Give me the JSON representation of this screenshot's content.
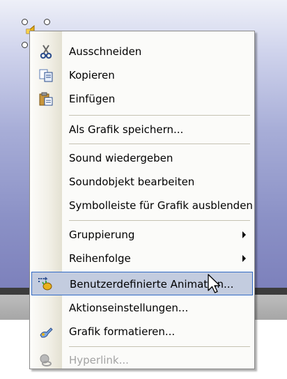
{
  "menu": {
    "items": [
      {
        "label": "Ausschneiden",
        "icon": "scissors-icon",
        "enabled": true
      },
      {
        "label": "Kopieren",
        "icon": "copy-icon",
        "enabled": true
      },
      {
        "label": "Einfügen",
        "icon": "paste-icon",
        "enabled": true
      },
      {
        "label": "Als Grafik speichern...",
        "enabled": true
      },
      {
        "label": "Sound wiedergeben",
        "enabled": true
      },
      {
        "label": "Soundobjekt bearbeiten",
        "enabled": true
      },
      {
        "label": "Symbolleiste für Grafik ausblenden",
        "enabled": true
      },
      {
        "label": "Gruppierung",
        "submenu": true,
        "enabled": true
      },
      {
        "label": "Reihenfolge",
        "submenu": true,
        "enabled": true
      },
      {
        "label": "Benutzerdefinierte Animation...",
        "icon": "custom-animation-icon",
        "highlighted": true,
        "enabled": true
      },
      {
        "label": "Aktionseinstellungen...",
        "enabled": true
      },
      {
        "label": "Grafik formatieren...",
        "icon": "format-picture-icon",
        "enabled": true
      },
      {
        "label": "Hyperlink...",
        "icon": "hyperlink-icon",
        "enabled": false
      }
    ]
  },
  "colors": {
    "highlight_bg": "#c3ccdf",
    "highlight_border": "#316ac5",
    "disabled_text": "#a3a3a3"
  }
}
